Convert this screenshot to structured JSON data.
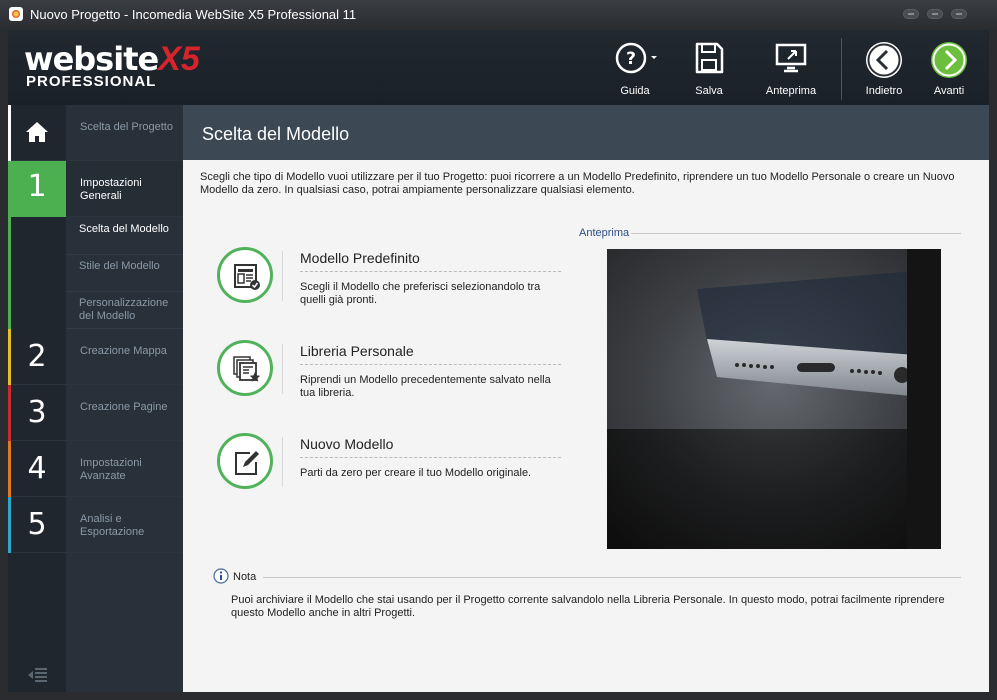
{
  "window": {
    "title": "Nuovo Progetto - Incomedia WebSite X5 Professional 11"
  },
  "logo": {
    "word": "website",
    "x5": "X5",
    "edition": "PROFESSIONAL"
  },
  "toolbar": {
    "guida": "Guida",
    "salva": "Salva",
    "anteprima": "Anteprima",
    "indietro": "Indietro",
    "avanti": "Avanti",
    "icons": [
      "help-icon",
      "save-icon",
      "preview-icon",
      "back-arrow-icon",
      "forward-arrow-icon"
    ]
  },
  "nav": {
    "home": {
      "label": "Scelta del Progetto"
    },
    "steps": [
      {
        "num": "1",
        "label": "Impostazioni Generali",
        "color": "#4caf50",
        "active": true,
        "subitems": [
          {
            "label": "Scelta del Modello",
            "active": true
          },
          {
            "label": "Stile del Modello"
          },
          {
            "label": "Personalizzazione del Modello"
          }
        ]
      },
      {
        "num": "2",
        "label": "Creazione Mappa",
        "color": "#e2c02a"
      },
      {
        "num": "3",
        "label": "Creazione Pagine",
        "color": "#c62b2f"
      },
      {
        "num": "4",
        "label": "Impostazioni Avanzate",
        "color": "#e07a22"
      },
      {
        "num": "5",
        "label": "Analisi e Esportazione",
        "color": "#2aa7c9"
      }
    ]
  },
  "main": {
    "title": "Scelta del Modello",
    "intro": "Scegli che tipo di Modello vuoi utilizzare per il tuo Progetto: puoi ricorrere a un Modello Predefinito, riprendere un tuo Modello Personale o creare un Nuovo Modello da zero. In qualsiasi caso, potrai ampiamente personalizzare qualsiasi elemento.",
    "options": [
      {
        "title": "Modello Predefinito",
        "desc": "Scegli il Modello che preferisci selezionandolo tra quelli già pronti."
      },
      {
        "title": "Libreria Personale",
        "desc": "Riprendi un Modello precedentemente salvato nella tua libreria."
      },
      {
        "title": "Nuovo Modello",
        "desc": "Parti da zero per creare il tuo Modello originale."
      }
    ],
    "preview_label": "Anteprima",
    "note_label": "Nota",
    "note_text": "Puoi archiviare il Modello che stai usando per il Progetto corrente salvandolo nella Libreria Personale. In questo modo, potrai facilmente riprendere questo Modello anche in altri Progetti."
  },
  "colors": {
    "accent_green": "#52b25c",
    "header_bg": "#3c4853",
    "link_blue": "#2b4e8a"
  }
}
